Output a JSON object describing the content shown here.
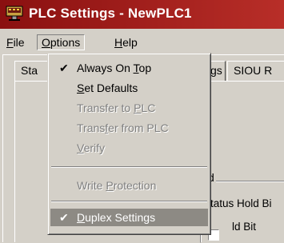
{
  "window": {
    "title": "PLC Settings - NewPLC1"
  },
  "menubar": [
    {
      "label": "File",
      "accel": "F",
      "rest": "ile"
    },
    {
      "label": "Options",
      "accel": "O",
      "rest": "ptions"
    },
    {
      "label": "Help",
      "accel": "H",
      "rest": "elp"
    }
  ],
  "tabs": [
    {
      "label": "Sta"
    },
    {
      "label": "gs"
    },
    {
      "label": "SIOU R"
    }
  ],
  "options_menu": {
    "items": [
      {
        "pre": "Always On ",
        "accel": "T",
        "post": "op",
        "checked": true,
        "enabled": true
      },
      {
        "pre": "",
        "accel": "S",
        "post": "et Defaults",
        "checked": false,
        "enabled": true
      },
      {
        "pre": "Transfer to ",
        "accel": "P",
        "post": "LC",
        "checked": false,
        "enabled": false
      },
      {
        "pre": "Trans",
        "accel": "f",
        "post": "er from PLC",
        "checked": false,
        "enabled": false
      },
      {
        "pre": "",
        "accel": "V",
        "post": "erify",
        "checked": false,
        "enabled": false
      },
      {
        "pre": "Write ",
        "accel": "P",
        "post": "rotection",
        "checked": false,
        "enabled": false
      },
      {
        "pre": "",
        "accel": "D",
        "post": "uplex Settings",
        "checked": true,
        "enabled": true,
        "highlighted": true
      }
    ],
    "check_glyph": "✔"
  },
  "background": {
    "frame_caption": "d",
    "check_labels": [
      "tatus Hold Bi",
      "ld Bit"
    ]
  },
  "colors": {
    "titlebar": "#9b1c1a",
    "highlight": "#8d8a84",
    "face": "#d4d0c8"
  }
}
